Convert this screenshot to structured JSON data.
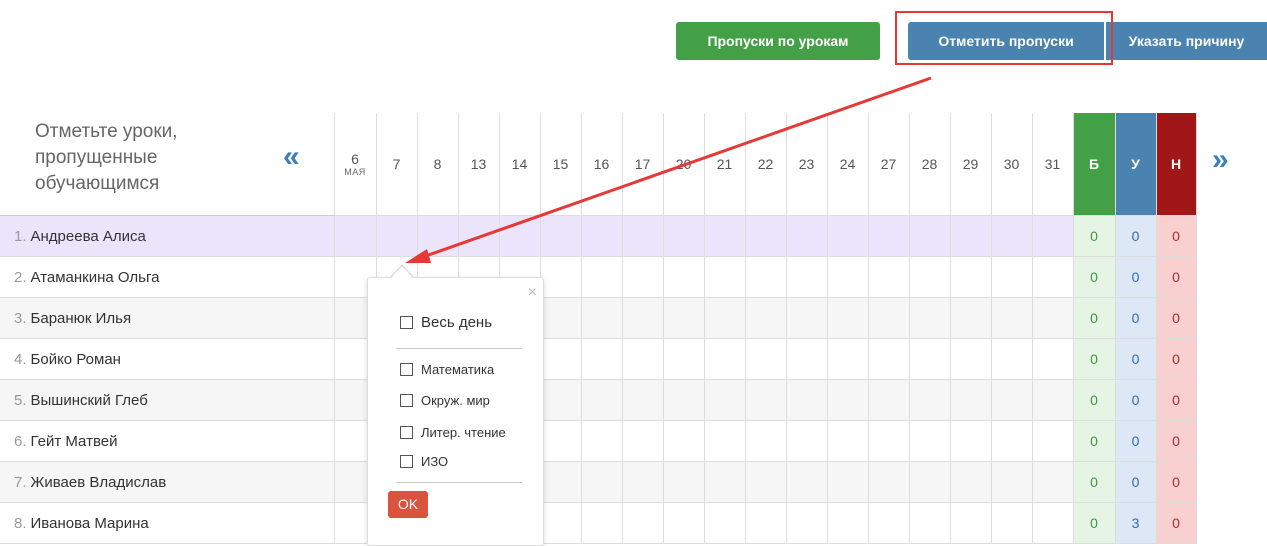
{
  "toolbar": {
    "lessons_absences_label": "Пропуски по урокам",
    "mark_absences_label": "Отметить пропуски",
    "reason_label": "Указать причину"
  },
  "header": {
    "instruction": "Отметьте уроки, пропущенные обучающимся",
    "prev_glyph": "«",
    "next_glyph": "»",
    "month": "МАЯ",
    "dates": [
      "6",
      "7",
      "8",
      "13",
      "14",
      "15",
      "16",
      "17",
      "20",
      "21",
      "22",
      "23",
      "24",
      "27",
      "28",
      "29",
      "30",
      "31"
    ],
    "col_b": "Б",
    "col_u": "У",
    "col_n": "Н"
  },
  "students": [
    {
      "num": "1.",
      "name": "Андреева Алиса",
      "b": "0",
      "u": "0",
      "n": "0"
    },
    {
      "num": "2.",
      "name": "Атаманкина Ольга",
      "b": "0",
      "u": "0",
      "n": "0"
    },
    {
      "num": "3.",
      "name": "Баранюк Илья",
      "b": "0",
      "u": "0",
      "n": "0"
    },
    {
      "num": "4.",
      "name": "Бойко Роман",
      "b": "0",
      "u": "0",
      "n": "0"
    },
    {
      "num": "5.",
      "name": "Вышинский Глеб",
      "b": "0",
      "u": "0",
      "n": "0"
    },
    {
      "num": "6.",
      "name": "Гейт Матвей",
      "b": "0",
      "u": "0",
      "n": "0"
    },
    {
      "num": "7.",
      "name": "Живаев Владислав",
      "b": "0",
      "u": "0",
      "n": "0"
    },
    {
      "num": "8.",
      "name": "Иванова Марина",
      "b": "0",
      "u": "3",
      "n": "0"
    }
  ],
  "popup": {
    "close_glyph": "×",
    "all_day_label": "Весь день",
    "lessons": [
      "Математика",
      "Окруж. мир",
      "Литер. чтение",
      "ИЗО"
    ],
    "ok_label": "OK"
  },
  "colors": {
    "green": "#43a047",
    "blue": "#4a82b0",
    "red": "#a11616",
    "highlight": "#e53935"
  }
}
